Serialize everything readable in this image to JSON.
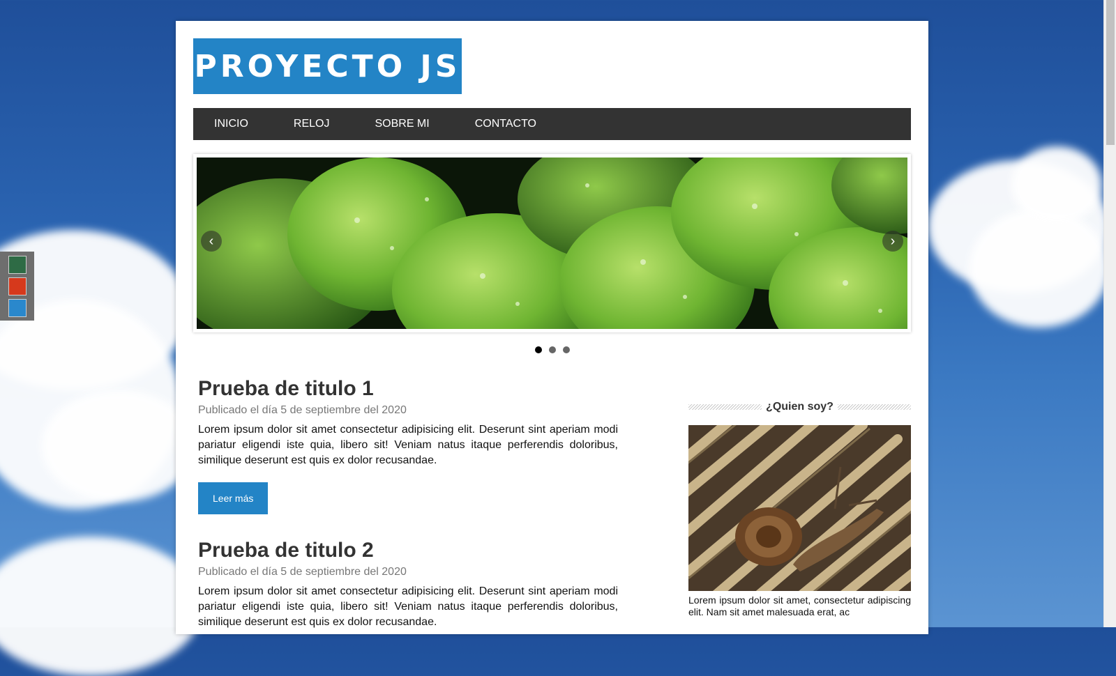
{
  "logo": {
    "text": "PROYECTO JS"
  },
  "nav": {
    "items": [
      "INICIO",
      "RELOJ",
      "SOBRE MI",
      "CONTACTO"
    ]
  },
  "slider": {
    "prev_icon": "chevron-left-icon",
    "next_icon": "chevron-right-icon",
    "dots": 3,
    "active_dot": 0
  },
  "theme_switcher": {
    "colors": [
      "#2e6b45",
      "#d6391c",
      "#2a88cc"
    ]
  },
  "articles": [
    {
      "title": "Prueba de titulo 1",
      "date": "Publicado el día 5 de septiembre del 2020",
      "body": "Lorem ipsum dolor sit amet consectetur adipisicing elit. Deserunt sint aperiam modi pariatur eligendi iste quia, libero sit! Veniam natus itaque perferendis doloribus, similique deserunt est quis ex dolor recusandae.",
      "button": "Leer más"
    },
    {
      "title": "Prueba de titulo 2",
      "date": "Publicado el día 5 de septiembre del 2020",
      "body": "Lorem ipsum dolor sit amet consectetur adipisicing elit. Deserunt sint aperiam modi pariatur eligendi iste quia, libero sit! Veniam natus itaque perferendis doloribus, similique deserunt est quis ex dolor recusandae."
    }
  ],
  "sidebar": {
    "title": "¿Quien soy?",
    "text": "Lorem ipsum dolor sit amet, consectetur adipiscing elit. Nam sit amet malesuada erat, ac"
  }
}
